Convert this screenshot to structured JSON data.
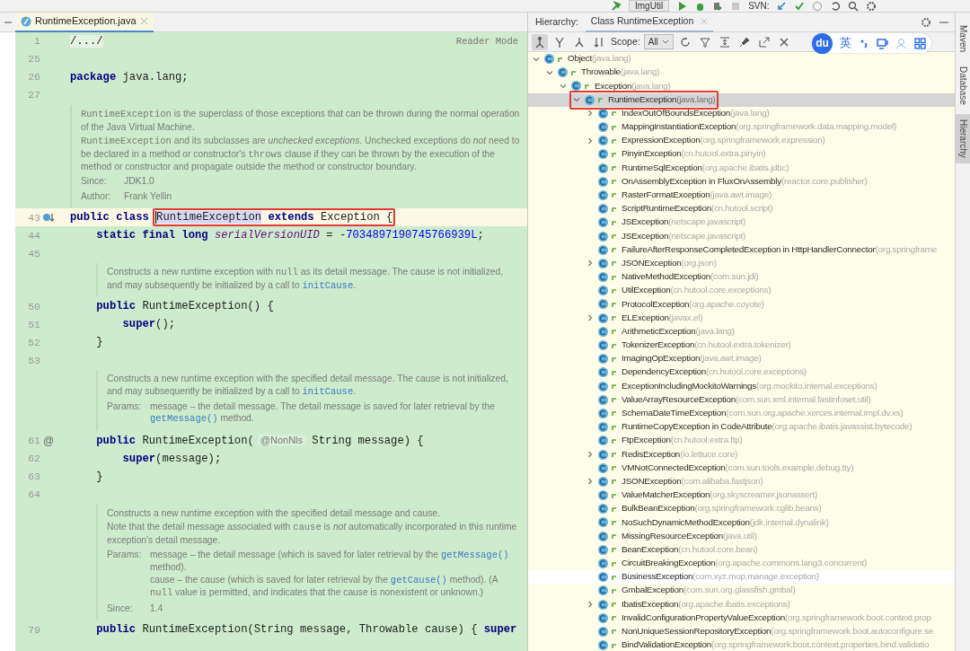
{
  "top_toolbar": {
    "run_config": "ImgUtil",
    "svn_label": "SVN:"
  },
  "editor": {
    "tab": {
      "label": "RuntimeException.java",
      "selected": true
    },
    "reader_mode": "Reader Mode",
    "lines": [
      {
        "kind": "code",
        "number": "1",
        "current": false,
        "tokens": [
          {
            "text": "/.../",
            "kind": "folded"
          }
        ]
      },
      {
        "kind": "code",
        "number": "25",
        "current": false
      },
      {
        "kind": "code",
        "number": "26",
        "current": false,
        "tokens": [
          {
            "text": "package",
            "kind": "keyword"
          },
          {
            "text": " java.lang;",
            "kind": "plain"
          }
        ]
      },
      {
        "kind": "code",
        "number": "27",
        "current": false
      },
      {
        "kind": "doc",
        "paragraphs": [
          {
            "kind": "text",
            "segments": [
              {
                "text": "RuntimeException",
                "kind": "mono"
              },
              {
                "text": " is the superclass of those exceptions that can be thrown during the normal operation of the Java Virtual Machine."
              }
            ]
          },
          {
            "kind": "text",
            "segments": [
              {
                "text": "RuntimeException",
                "kind": "mono"
              },
              {
                "text": " and its subclasses are "
              },
              {
                "text": "unchecked exceptions",
                "kind": "italic"
              },
              {
                "text": ". Unchecked exceptions do "
              },
              {
                "text": "not",
                "kind": "italic"
              },
              {
                "text": " need to be declared in a method or constructor's "
              },
              {
                "text": "throws",
                "kind": "mono"
              },
              {
                "text": " clause if they can be thrown by the execution of the method or constructor and propagate outside the method or constructor boundary."
              }
            ]
          },
          {
            "kind": "field",
            "label": "Since:",
            "entries": [
              [
                {
                  "text": "JDK1.0"
                }
              ]
            ]
          },
          {
            "kind": "field",
            "label": "Author:",
            "entries": [
              [
                {
                  "text": "Frank Yellin"
                }
              ]
            ]
          }
        ]
      },
      {
        "kind": "code",
        "number": "43",
        "current": true,
        "gutter": {
          "kind": "override"
        },
        "tokens": [
          {
            "text": "public class ",
            "kind": "keyword",
            "boxed": false
          },
          {
            "text": "RuntimeException",
            "kind": "selection",
            "boxed": true
          },
          {
            "text": " extends ",
            "kind": "keyword",
            "boxed": true
          },
          {
            "text": "Exception {",
            "kind": "plain",
            "boxed": true
          }
        ]
      },
      {
        "kind": "code",
        "number": "44",
        "current": false,
        "tokens": [
          {
            "text": "    static final long ",
            "kind": "keyword"
          },
          {
            "text": "serialVersionUID",
            "kind": "field"
          },
          {
            "text": " = -",
            "kind": "plain"
          },
          {
            "text": "7034897190745766939L",
            "kind": "number"
          },
          {
            "text": ";",
            "kind": "plain"
          }
        ]
      },
      {
        "kind": "code",
        "number": "45",
        "current": false
      },
      {
        "kind": "member_doc",
        "paragraphs": [
          {
            "kind": "text",
            "segments": [
              {
                "text": "Constructs a new runtime exception with "
              },
              {
                "text": "null",
                "kind": "mono"
              },
              {
                "text": " as its detail message. The cause is not initialized, and may subsequently be initialized by a call to "
              },
              {
                "text": "initCause",
                "kind": "link"
              },
              {
                "text": "."
              }
            ]
          }
        ]
      },
      {
        "kind": "code",
        "number": "50",
        "current": false,
        "tokens": [
          {
            "text": "    public",
            "kind": "keyword"
          },
          {
            "text": " RuntimeException() {",
            "kind": "plain"
          }
        ]
      },
      {
        "kind": "code",
        "number": "51",
        "current": false,
        "tokens": [
          {
            "text": "        super",
            "kind": "keyword"
          },
          {
            "text": "();",
            "kind": "plain"
          }
        ]
      },
      {
        "kind": "code",
        "number": "52",
        "current": false,
        "tokens": [
          {
            "text": "    }",
            "kind": "plain"
          }
        ]
      },
      {
        "kind": "code",
        "number": "53",
        "current": false
      },
      {
        "kind": "member_doc",
        "paragraphs": [
          {
            "kind": "text",
            "segments": [
              {
                "text": "Constructs a new runtime exception with the specified detail message. The cause is not initialized, and may subsequently be initialized by a call to "
              },
              {
                "text": "initCause",
                "kind": "link"
              },
              {
                "text": "."
              }
            ]
          },
          {
            "kind": "field",
            "label": "Params:",
            "entries": [
              [
                {
                  "text": "message – the detail message. The detail message is saved for later retrieval by the "
                },
                {
                  "text": "getMessage()",
                  "kind": "link"
                },
                {
                  "text": " method."
                }
              ]
            ]
          }
        ]
      },
      {
        "kind": "code",
        "number": "61",
        "current": false,
        "gutter": {
          "kind": "text",
          "text": "@"
        },
        "tokens": [
          {
            "text": "    public",
            "kind": "keyword"
          },
          {
            "text": " RuntimeException(",
            "kind": "plain"
          },
          {
            "text": "@NonNls",
            "kind": "inlay"
          },
          {
            "text": " String message) {",
            "kind": "plain"
          }
        ]
      },
      {
        "kind": "code",
        "number": "62",
        "current": false,
        "tokens": [
          {
            "text": "        super",
            "kind": "keyword"
          },
          {
            "text": "(message);",
            "kind": "plain"
          }
        ]
      },
      {
        "kind": "code",
        "number": "63",
        "current": false,
        "tokens": [
          {
            "text": "    }",
            "kind": "plain"
          }
        ]
      },
      {
        "kind": "code",
        "number": "64",
        "current": false
      },
      {
        "kind": "member_doc",
        "paragraphs": [
          {
            "kind": "text",
            "segments": [
              {
                "text": "Constructs a new runtime exception with the specified detail message and cause."
              }
            ]
          },
          {
            "kind": "text",
            "segments": [
              {
                "text": "Note that the detail message associated with "
              },
              {
                "text": "cause",
                "kind": "mono"
              },
              {
                "text": " is "
              },
              {
                "text": "not",
                "kind": "italic"
              },
              {
                "text": " automatically incorporated in this runtime exception's detail message."
              }
            ]
          },
          {
            "kind": "field",
            "label": "Params:",
            "entries": [
              [
                {
                  "text": "message – the detail message (which is saved for later retrieval by the "
                },
                {
                  "text": "getMessage()",
                  "kind": "link"
                },
                {
                  "text": " method)."
                }
              ],
              [
                {
                  "text": "cause – the cause (which is saved for later retrieval by the "
                },
                {
                  "text": "getCause()",
                  "kind": "link"
                },
                {
                  "text": " method). (A "
                },
                {
                  "text": "null",
                  "kind": "mono"
                },
                {
                  "text": " value is permitted, and indicates that the cause is nonexistent or unknown.)"
                }
              ]
            ]
          },
          {
            "kind": "field",
            "label": "Since:",
            "entries": [
              [
                {
                  "text": "1.4"
                }
              ]
            ]
          }
        ]
      },
      {
        "kind": "code",
        "number": "79",
        "current": false,
        "tokens": [
          {
            "text": "    public",
            "kind": "keyword"
          },
          {
            "text": " RuntimeException(String message, Throwable cause) { ",
            "kind": "plain"
          },
          {
            "text": "super",
            "kind": "keyword"
          }
        ]
      }
    ]
  },
  "hierarchy": {
    "label": "Hierarchy:",
    "tabs": [
      {
        "label": "Class RuntimeException",
        "selected": true
      }
    ],
    "scope_label": "Scope:",
    "scope_value": "All",
    "tree": [
      {
        "name": "Object",
        "package": "(java.lang)",
        "expanded": true,
        "selected": false,
        "hovered": false,
        "boxed": false,
        "children": [
          {
            "name": "Throwable",
            "package": "(java.lang)",
            "expanded": true,
            "selected": false,
            "hovered": false,
            "boxed": false,
            "children": [
              {
                "name": "Exception",
                "package": "(java.lang)",
                "expanded": true,
                "selected": false,
                "hovered": false,
                "boxed": false,
                "children": [
                  {
                    "name": "RuntimeException",
                    "package": "(java.lang)",
                    "expanded": true,
                    "selected": true,
                    "hovered": false,
                    "boxed": true,
                    "children": [
                      {
                        "name": "IndexOutOfBoundsException",
                        "package": "(java.lang)",
                        "expanded": false,
                        "selected": false,
                        "hovered": false,
                        "boxed": false
                      },
                      {
                        "name": "MappingInstantiationException",
                        "package": "(org.springframework.data.mapping.model)",
                        "selected": false,
                        "hovered": false,
                        "boxed": false
                      },
                      {
                        "name": "ExpressionException",
                        "package": "(org.springframework.expression)",
                        "expanded": false,
                        "selected": false,
                        "hovered": false,
                        "boxed": false
                      },
                      {
                        "name": "PinyinException",
                        "package": "(cn.hutool.extra.pinyin)",
                        "selected": false,
                        "hovered": false,
                        "boxed": false
                      },
                      {
                        "name": "RuntimeSqlException",
                        "package": "(org.apache.ibatis.jdbc)",
                        "selected": false,
                        "hovered": false,
                        "boxed": false
                      },
                      {
                        "name": "OnAssemblyException in FluxOnAssembly",
                        "package": "(reactor.core.publisher)",
                        "selected": false,
                        "hovered": false,
                        "boxed": false
                      },
                      {
                        "name": "RasterFormatException",
                        "package": "(java.awt.image)",
                        "selected": false,
                        "hovered": false,
                        "boxed": false
                      },
                      {
                        "name": "ScriptRuntimeException",
                        "package": "(cn.hutool.script)",
                        "selected": false,
                        "hovered": false,
                        "boxed": false
                      },
                      {
                        "name": "JSException",
                        "package": "(netscape.javascript)",
                        "selected": false,
                        "hovered": false,
                        "boxed": false
                      },
                      {
                        "name": "JSException",
                        "package": "(netscape.javascript)",
                        "selected": false,
                        "hovered": false,
                        "boxed": false
                      },
                      {
                        "name": "FailureAfterResponseCompletedException in HttpHandlerConnector",
                        "package": "(org.springframe",
                        "selected": false,
                        "hovered": false,
                        "boxed": false
                      },
                      {
                        "name": "JSONException",
                        "package": "(org.json)",
                        "expanded": false,
                        "selected": false,
                        "hovered": false,
                        "boxed": false
                      },
                      {
                        "name": "NativeMethodException",
                        "package": "(com.sun.jdi)",
                        "selected": false,
                        "hovered": false,
                        "boxed": false
                      },
                      {
                        "name": "UtilException",
                        "package": "(cn.hutool.core.exceptions)",
                        "selected": false,
                        "hovered": false,
                        "boxed": false
                      },
                      {
                        "name": "ProtocolException",
                        "package": "(org.apache.coyote)",
                        "selected": false,
                        "hovered": false,
                        "boxed": false
                      },
                      {
                        "name": "ELException",
                        "package": "(javax.el)",
                        "expanded": false,
                        "selected": false,
                        "hovered": false,
                        "boxed": false
                      },
                      {
                        "name": "ArithmeticException",
                        "package": "(java.lang)",
                        "selected": false,
                        "hovered": false,
                        "boxed": false
                      },
                      {
                        "name": "TokenizerException",
                        "package": "(cn.hutool.extra.tokenizer)",
                        "selected": false,
                        "hovered": false,
                        "boxed": false
                      },
                      {
                        "name": "ImagingOpException",
                        "package": "(java.awt.image)",
                        "selected": false,
                        "hovered": false,
                        "boxed": false
                      },
                      {
                        "name": "DependencyException",
                        "package": "(cn.hutool.core.exceptions)",
                        "selected": false,
                        "hovered": false,
                        "boxed": false
                      },
                      {
                        "name": "ExceptionIncludingMockitoWarnings",
                        "package": "(org.mockito.internal.exceptions)",
                        "selected": false,
                        "hovered": false,
                        "boxed": false
                      },
                      {
                        "name": "ValueArrayResourceException",
                        "package": "(com.sun.xml.internal.fastinfoset.util)",
                        "selected": false,
                        "hovered": false,
                        "boxed": false
                      },
                      {
                        "name": "SchemaDateTimeException",
                        "package": "(com.sun.org.apache.xerces.internal.impl.dv.xs)",
                        "selected": false,
                        "hovered": false,
                        "boxed": false
                      },
                      {
                        "name": "RuntimeCopyException in CodeAttribute",
                        "package": "(org.apache.ibatis.javassist.bytecode)",
                        "selected": false,
                        "hovered": false,
                        "boxed": false
                      },
                      {
                        "name": "FtpException",
                        "package": "(cn.hutool.extra.ftp)",
                        "selected": false,
                        "hovered": false,
                        "boxed": false
                      },
                      {
                        "name": "RedisException",
                        "package": "(io.lettuce.core)",
                        "expanded": false,
                        "selected": false,
                        "hovered": false,
                        "boxed": false
                      },
                      {
                        "name": "VMNotConnectedException",
                        "package": "(com.sun.tools.example.debug.tty)",
                        "selected": false,
                        "hovered": false,
                        "boxed": false
                      },
                      {
                        "name": "JSONException",
                        "package": "(com.alibaba.fastjson)",
                        "expanded": false,
                        "selected": false,
                        "hovered": false,
                        "boxed": false
                      },
                      {
                        "name": "ValueMatcherException",
                        "package": "(org.skyscreamer.jsonassert)",
                        "selected": false,
                        "hovered": false,
                        "boxed": false
                      },
                      {
                        "name": "BulkBeanException",
                        "package": "(org.springframework.cglib.beans)",
                        "selected": false,
                        "hovered": false,
                        "boxed": false
                      },
                      {
                        "name": "NoSuchDynamicMethodException",
                        "package": "(jdk.internal.dynalink)",
                        "selected": false,
                        "hovered": false,
                        "boxed": false
                      },
                      {
                        "name": "MissingResourceException",
                        "package": "(java.util)",
                        "selected": false,
                        "hovered": false,
                        "boxed": false
                      },
                      {
                        "name": "BeanException",
                        "package": "(cn.hutool.core.bean)",
                        "selected": false,
                        "hovered": false,
                        "boxed": false
                      },
                      {
                        "name": "CircuitBreakingException",
                        "package": "(org.apache.commons.lang3.concurrent)",
                        "selected": false,
                        "hovered": false,
                        "boxed": false
                      },
                      {
                        "name": "BusinessException",
                        "package": "(com.xyz.mop.manage.exception)",
                        "selected": false,
                        "hovered": true,
                        "boxed": false
                      },
                      {
                        "name": "GmbalException",
                        "package": "(com.sun.org.glassfish.gmbal)",
                        "selected": false,
                        "hovered": false,
                        "boxed": false
                      },
                      {
                        "name": "IbatisException",
                        "package": "(org.apache.ibatis.exceptions)",
                        "expanded": false,
                        "selected": false,
                        "hovered": false,
                        "boxed": false
                      },
                      {
                        "name": "InvalidConfigurationPropertyValueException",
                        "package": "(org.springframework.boot.context.prop",
                        "selected": false,
                        "hovered": false,
                        "boxed": false
                      },
                      {
                        "name": "NonUniqueSessionRepositoryException",
                        "package": "(org.springframework.boot.autoconfigure.se",
                        "selected": false,
                        "hovered": false,
                        "boxed": false
                      },
                      {
                        "name": "BindValidationException",
                        "package": "(org.springframework.boot.context.properties.bind.validatio",
                        "selected": false,
                        "hovered": false,
                        "boxed": false
                      }
                    ]
                  }
                ]
              }
            ]
          }
        ]
      }
    ]
  },
  "ime_toolbar": {
    "logo": "du",
    "mode": "英"
  },
  "side_tabs": [
    {
      "label": "Maven",
      "selected": false
    },
    {
      "label": "Database",
      "selected": false
    },
    {
      "label": "Hierarchy",
      "selected": true
    }
  ]
}
